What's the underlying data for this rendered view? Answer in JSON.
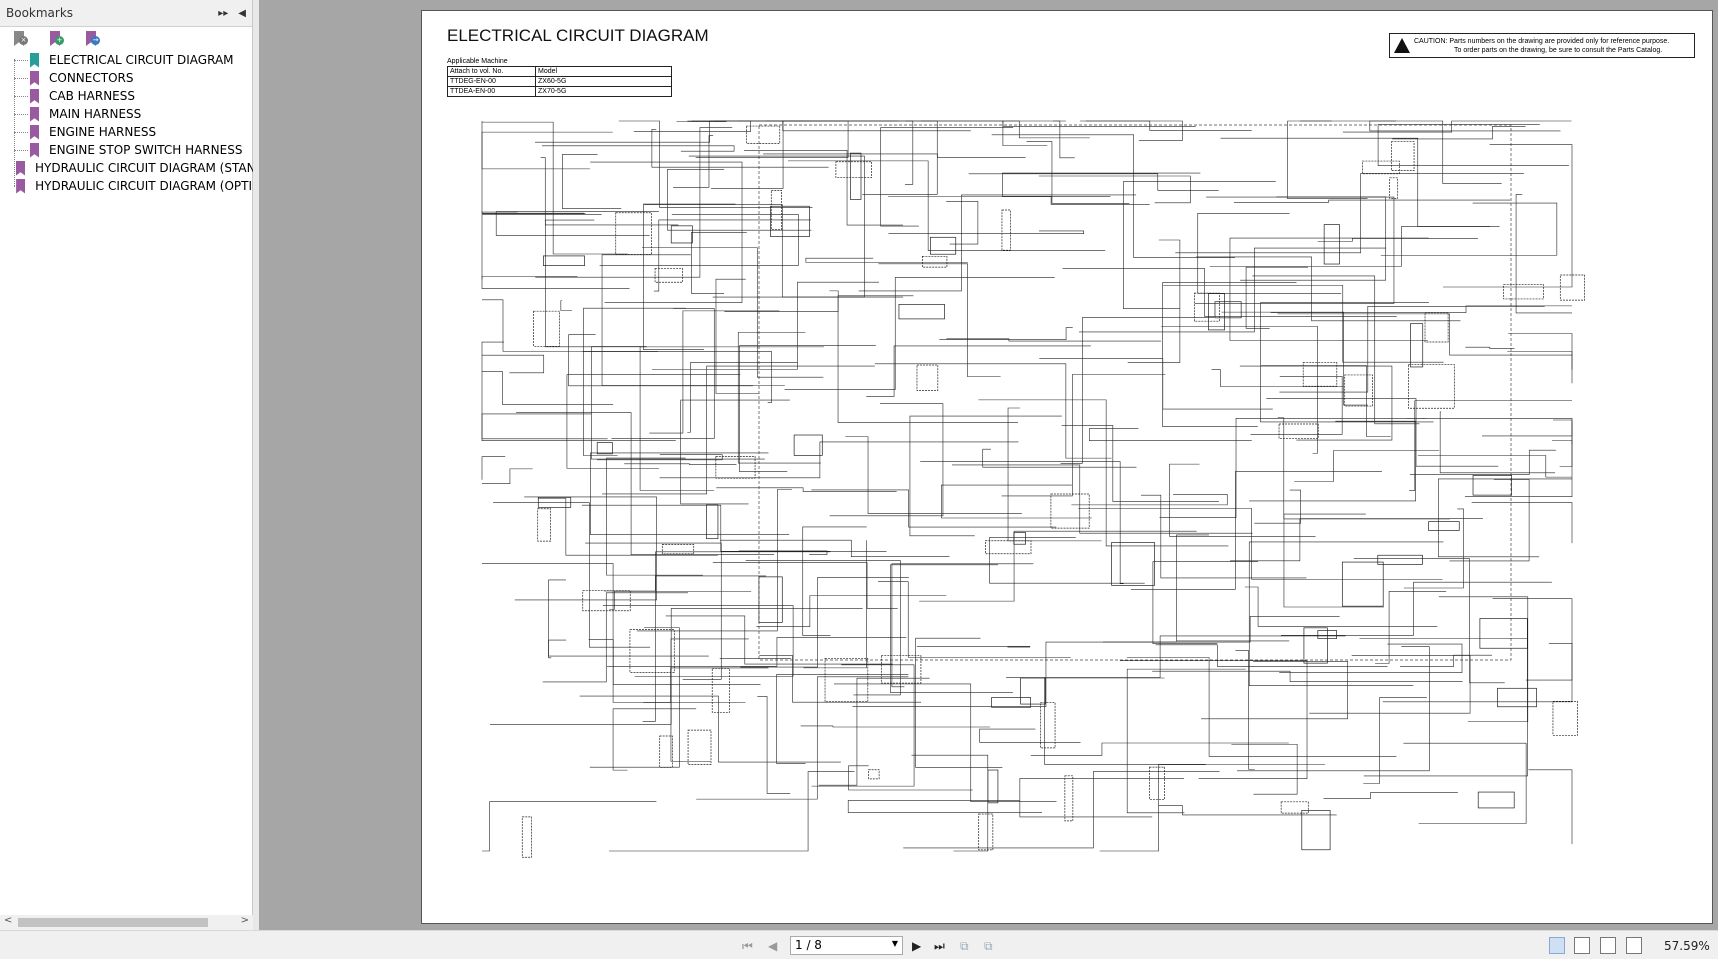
{
  "sidebar": {
    "title": "Bookmarks",
    "items": [
      {
        "label": "ELECTRICAL CIRCUIT DIAGRAM",
        "color": "#2a9d9a"
      },
      {
        "label": "CONNECTORS",
        "color": "#9a5aa0"
      },
      {
        "label": "CAB HARNESS",
        "color": "#9a5aa0"
      },
      {
        "label": "MAIN HARNESS",
        "color": "#9a5aa0"
      },
      {
        "label": "ENGINE HARNESS",
        "color": "#9a5aa0"
      },
      {
        "label": "ENGINE STOP SWITCH HARNESS",
        "color": "#9a5aa0"
      },
      {
        "label": "HYDRAULIC CIRCUIT DIAGRAM (STAN",
        "color": "#9a5aa0"
      },
      {
        "label": "HYDRAULIC CIRCUIT DIAGRAM (OPTI",
        "color": "#9a5aa0"
      }
    ]
  },
  "document": {
    "title": "ELECTRICAL CIRCUIT DIAGRAM",
    "applicable_label": "Applicable Machine",
    "table": {
      "headers": [
        "Attach to vol. No.",
        "Model"
      ],
      "rows": [
        [
          "TTDEG-EN-00",
          "ZX60-5G"
        ],
        [
          "TTDEA-EN-00",
          "ZX70-5G"
        ]
      ]
    },
    "caution_line1": "CAUTION: Parts numbers on the drawing are provided only for reference purpose.",
    "caution_line2": "To order parts on the drawing, be sure to consult the Parts Catalog."
  },
  "toolbar": {
    "page": "1 / 8",
    "zoom": "57.59%"
  }
}
